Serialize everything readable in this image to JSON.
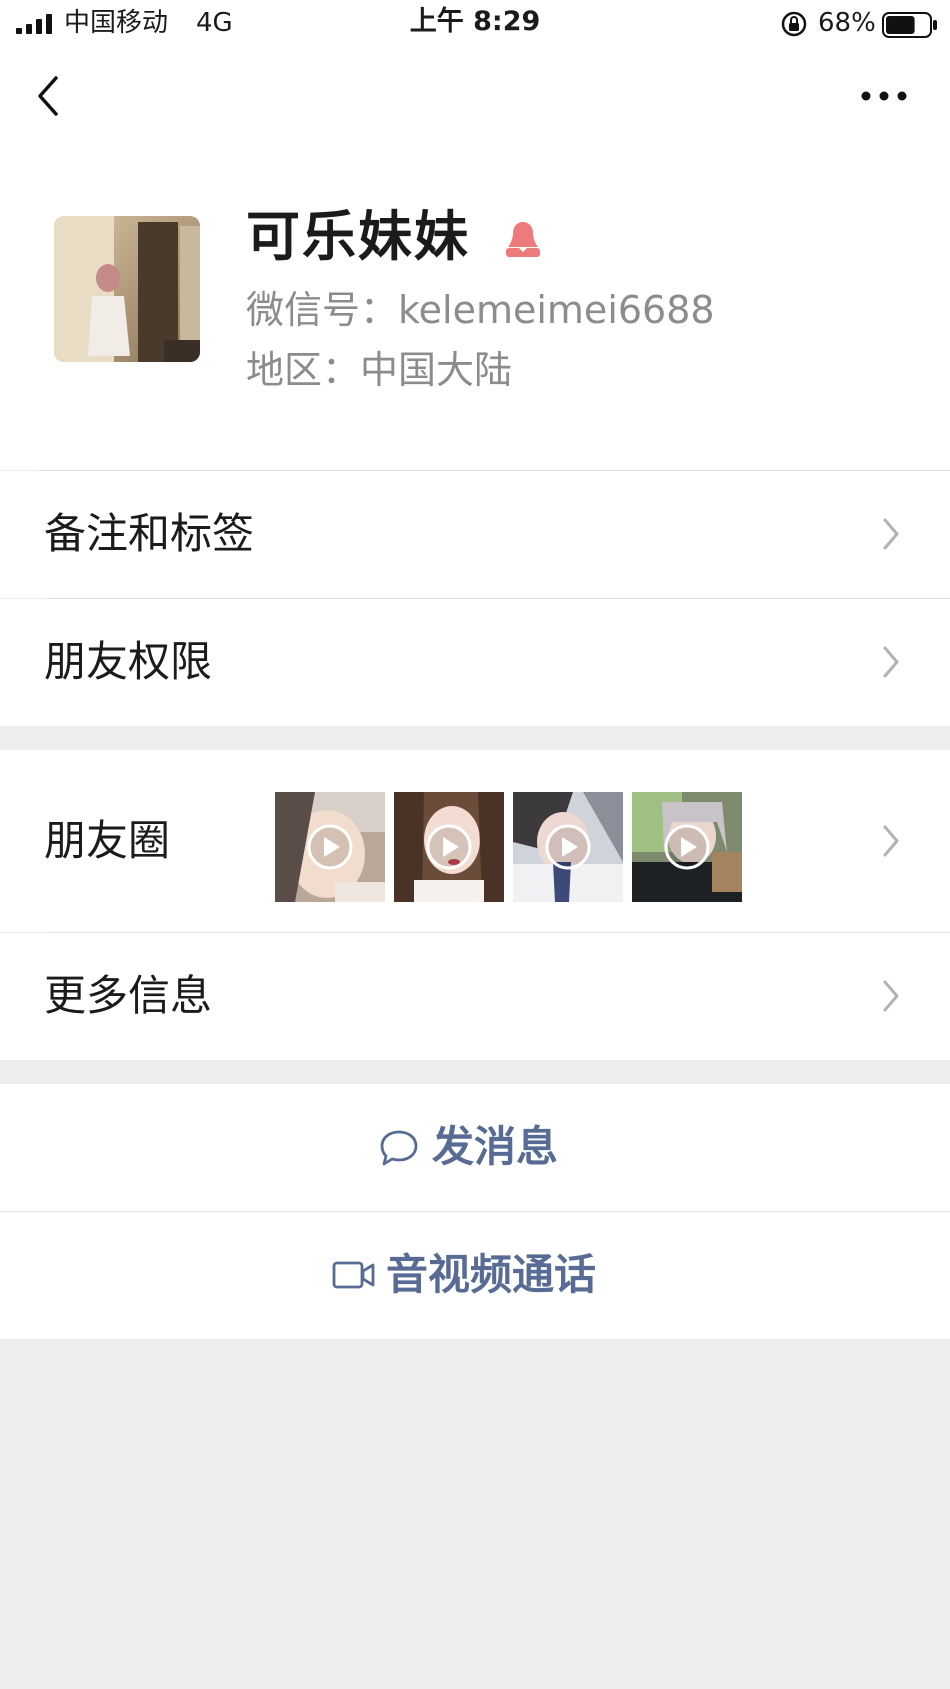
{
  "status_bar": {
    "carrier": "中国移动",
    "network": "4G",
    "time": "上午 8:29",
    "battery_percent": "68%",
    "battery_level": 0.68
  },
  "nav": {
    "back_icon": "chevron-left-icon",
    "more_icon": "more-dots-icon"
  },
  "profile": {
    "name": "可乐妹妹",
    "gender_icon": "female-icon",
    "gender_color": "#ee7b7b",
    "wechat_id": "微信号：kelemeimei6688",
    "region": "地区：中国大陆"
  },
  "menu": {
    "remarks_tags": "备注和标签",
    "friend_permissions": "朋友权限",
    "moments": "朋友圈",
    "more_info": "更多信息"
  },
  "moments_thumbnails": [
    {
      "type": "video"
    },
    {
      "type": "video"
    },
    {
      "type": "video"
    },
    {
      "type": "video"
    }
  ],
  "actions": {
    "send_message": "发消息",
    "video_call": "音视频通话",
    "accent_color": "#576b95"
  }
}
